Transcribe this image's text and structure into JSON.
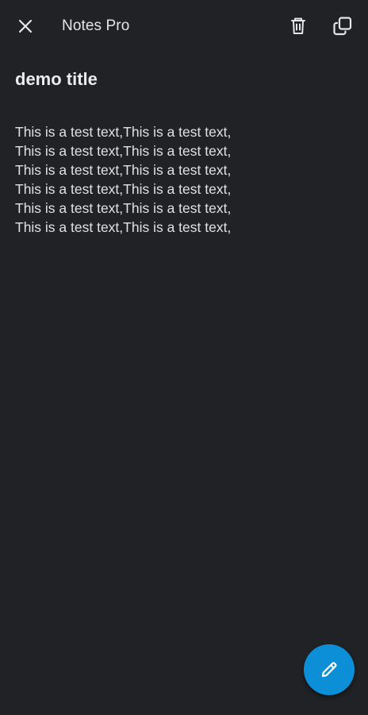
{
  "app": {
    "title": "Notes Pro"
  },
  "toolbar": {
    "close_icon": "close-icon",
    "delete_icon": "trash-icon",
    "copy_icon": "copy-icon"
  },
  "note": {
    "title": "demo title",
    "lines": [
      "This is a test text,This is a test text,",
      "This is a test text,This is a test text,",
      "This is a test text,This is a test text,",
      "This is a test text,This is a test text,",
      "This is a test text,This is a test text,",
      "This is a test text,This is a test text,"
    ]
  },
  "fab": {
    "icon": "pencil-icon",
    "color": "#0c8fd6"
  },
  "colors": {
    "background": "#212226",
    "text": "#e3e3e6"
  }
}
